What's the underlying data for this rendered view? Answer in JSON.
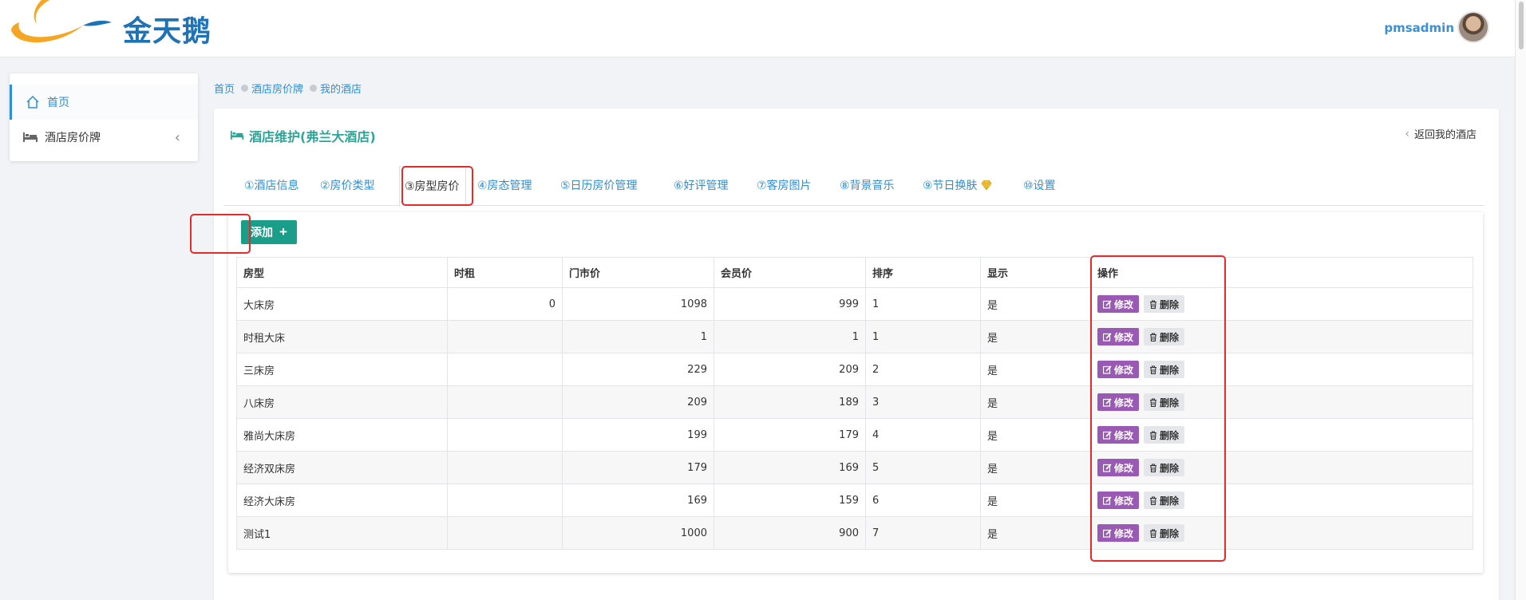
{
  "header": {
    "logo_text": "金天鹅",
    "user_name": "pmsadmin"
  },
  "sidebar": {
    "items": [
      {
        "label": "首页",
        "icon": "home-icon"
      },
      {
        "label": "酒店房价牌",
        "icon": "bed-icon"
      }
    ]
  },
  "breadcrumb": [
    "首页",
    "酒店房价牌",
    "我的酒店"
  ],
  "panel": {
    "title": "酒店维护(弗兰大酒店)",
    "back_link": "返回我的酒店"
  },
  "tabs": [
    {
      "label": "①酒店信息"
    },
    {
      "label": "②房价类型"
    },
    {
      "label": "③房型房价"
    },
    {
      "label": "④房态管理"
    },
    {
      "label": "⑤日历房价管理"
    },
    {
      "label": "⑥好评管理"
    },
    {
      "label": "⑦客房图片"
    },
    {
      "label": "⑧背景音乐"
    },
    {
      "label": "⑨节日换肤"
    },
    {
      "label": "⑩设置"
    }
  ],
  "active_tab": "③房型房价",
  "add_button": "添加",
  "table": {
    "headers": [
      "房型",
      "时租",
      "门市价",
      "会员价",
      "排序",
      "显示",
      "操作"
    ],
    "edit_label": "修改",
    "delete_label": "删除",
    "rows": [
      {
        "room_type": "大床房",
        "hourly": "0",
        "rack_price": "1098",
        "member_price": "999",
        "sort": "1",
        "show": "是"
      },
      {
        "room_type": "时租大床",
        "hourly": "",
        "rack_price": "1",
        "member_price": "1",
        "sort": "1",
        "show": "是"
      },
      {
        "room_type": "三床房",
        "hourly": "",
        "rack_price": "229",
        "member_price": "209",
        "sort": "2",
        "show": "是"
      },
      {
        "room_type": "八床房",
        "hourly": "",
        "rack_price": "209",
        "member_price": "189",
        "sort": "3",
        "show": "是"
      },
      {
        "room_type": "雅尚大床房",
        "hourly": "",
        "rack_price": "199",
        "member_price": "179",
        "sort": "4",
        "show": "是"
      },
      {
        "room_type": "经济双床房",
        "hourly": "",
        "rack_price": "179",
        "member_price": "169",
        "sort": "5",
        "show": "是"
      },
      {
        "room_type": "经济大床房",
        "hourly": "",
        "rack_price": "169",
        "member_price": "159",
        "sort": "6",
        "show": "是"
      },
      {
        "room_type": "测试1",
        "hourly": "",
        "rack_price": "1000",
        "member_price": "900",
        "sort": "7",
        "show": "是"
      }
    ]
  },
  "colors": {
    "brand_blue": "#1c73b8",
    "logo_orange": "#f6a623",
    "title_teal": "#2ba696",
    "add_button": "#1a9e8a",
    "edit_button": "#9b59b6",
    "highlight_red": "#e52a2a"
  }
}
